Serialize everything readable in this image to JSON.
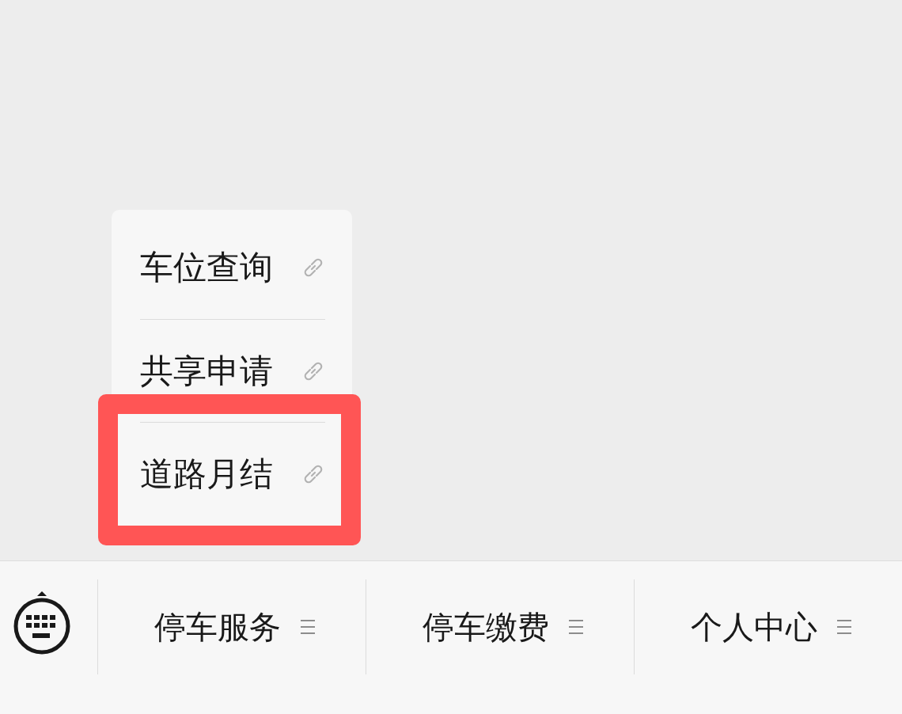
{
  "popup_menu": {
    "items": [
      {
        "label": "车位查询",
        "highlighted": false
      },
      {
        "label": "共享申请",
        "highlighted": false
      },
      {
        "label": "道路月结",
        "highlighted": true
      }
    ]
  },
  "bottom_menu": {
    "tabs": [
      {
        "label": "停车服务"
      },
      {
        "label": "停车缴费"
      },
      {
        "label": "个人中心"
      }
    ]
  }
}
